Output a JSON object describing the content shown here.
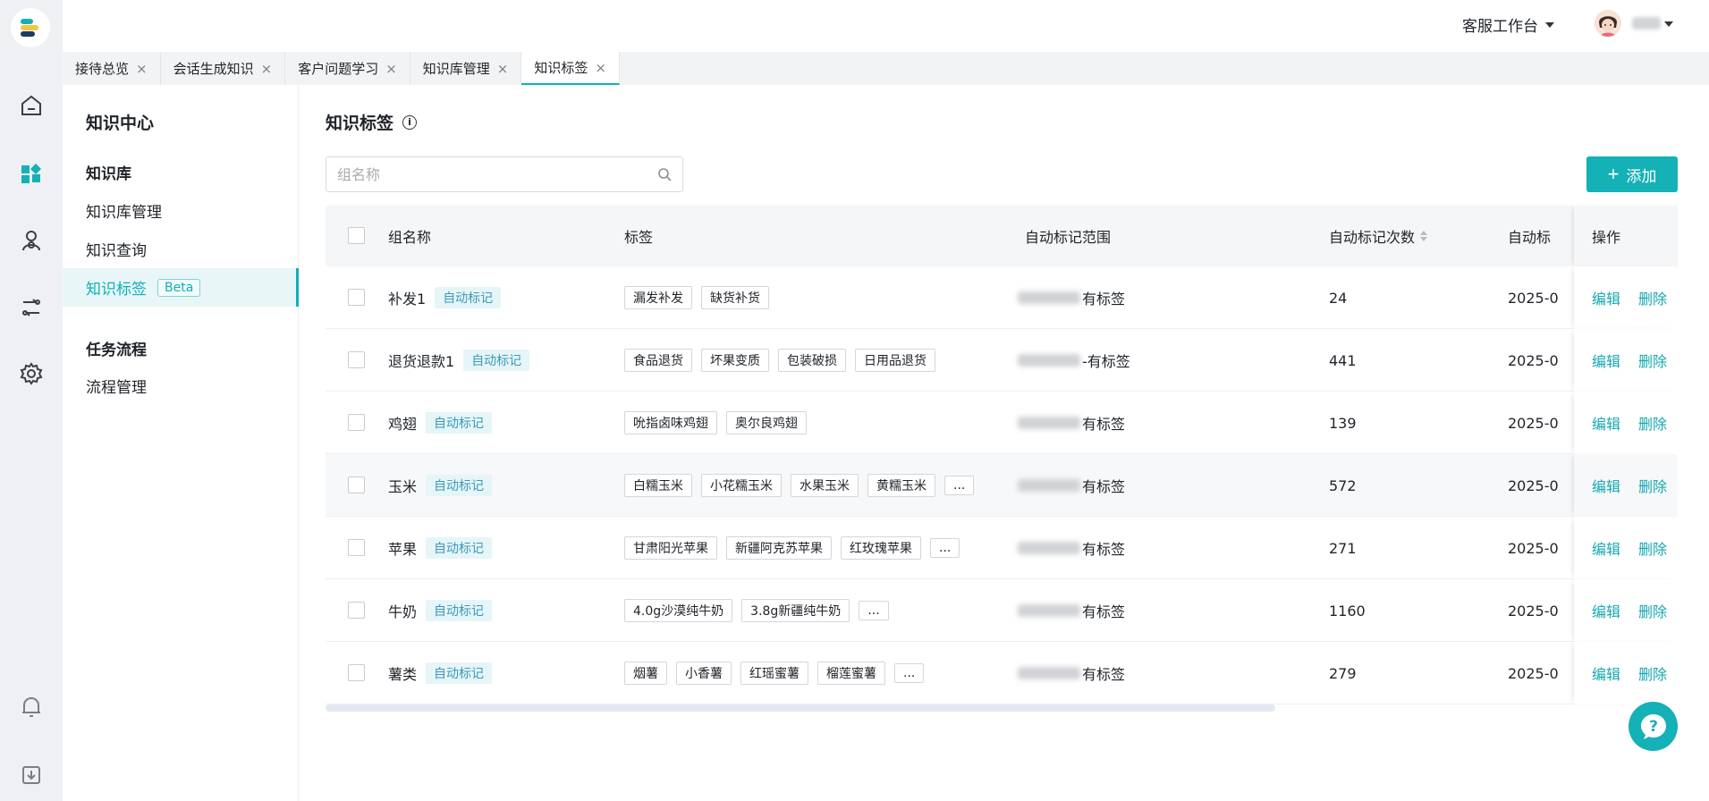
{
  "topbar": {
    "workspace": "客服工作台"
  },
  "tabs": [
    {
      "label": "接待总览",
      "close": "×"
    },
    {
      "label": "会话生成知识",
      "close": "×"
    },
    {
      "label": "客户问题学习",
      "close": "×"
    },
    {
      "label": "知识库管理",
      "close": "×"
    },
    {
      "label": "知识标签",
      "close": "×"
    }
  ],
  "sidebar": {
    "title": "知识中心",
    "group1": "知识库",
    "items1": [
      "知识库管理",
      "知识查询",
      "知识标签"
    ],
    "beta": "Beta",
    "group2": "任务流程",
    "items2": [
      "流程管理"
    ]
  },
  "main": {
    "title": "知识标签",
    "info_glyph": "i",
    "search_placeholder": "组名称",
    "add_label": "添加",
    "add_glyph": "+"
  },
  "table": {
    "headers": {
      "name": "组名称",
      "tags": "标签",
      "scope": "自动标记范围",
      "count": "自动标记次数",
      "time": "自动标",
      "ops": "操作"
    },
    "auto_label": "自动标记",
    "edit": "编辑",
    "delete": "删除",
    "more": "...",
    "rows": [
      {
        "name": "补发1",
        "tags": [
          "漏发补发",
          "缺货补货"
        ],
        "more": false,
        "scope": "有标签",
        "count": "24",
        "time": "2025-0"
      },
      {
        "name": "退货退款1",
        "tags": [
          "食品退货",
          "坏果变质",
          "包装破损",
          "日用品退货"
        ],
        "more": false,
        "scope": "-有标签",
        "count": "441",
        "time": "2025-0"
      },
      {
        "name": "鸡翅",
        "tags": [
          "吮指卤味鸡翅",
          "奥尔良鸡翅"
        ],
        "more": false,
        "scope": "有标签",
        "count": "139",
        "time": "2025-0"
      },
      {
        "name": "玉米",
        "tags": [
          "白糯玉米",
          "小花糯玉米",
          "水果玉米",
          "黄糯玉米"
        ],
        "more": true,
        "scope": "有标签",
        "count": "572",
        "time": "2025-0"
      },
      {
        "name": "苹果",
        "tags": [
          "甘肃阳光苹果",
          "新疆阿克苏苹果",
          "红玫瑰苹果"
        ],
        "more": true,
        "scope": "有标签",
        "count": "271",
        "time": "2025-0"
      },
      {
        "name": "牛奶",
        "tags": [
          "4.0g沙漠纯牛奶",
          "3.8g新疆纯牛奶"
        ],
        "more": true,
        "scope": "有标签",
        "count": "1160",
        "time": "2025-0"
      },
      {
        "name": "薯类",
        "tags": [
          "烟薯",
          "小香薯",
          "红瑶蜜薯",
          "榴莲蜜薯"
        ],
        "more": true,
        "scope": "有标签",
        "count": "279",
        "time": "2025-0"
      }
    ]
  },
  "colors": {
    "accent": "#14b1b6",
    "link": "#14a8b1",
    "auto_tag_bg": "#e6f5f8",
    "auto_tag_text": "#3a9ab8"
  }
}
